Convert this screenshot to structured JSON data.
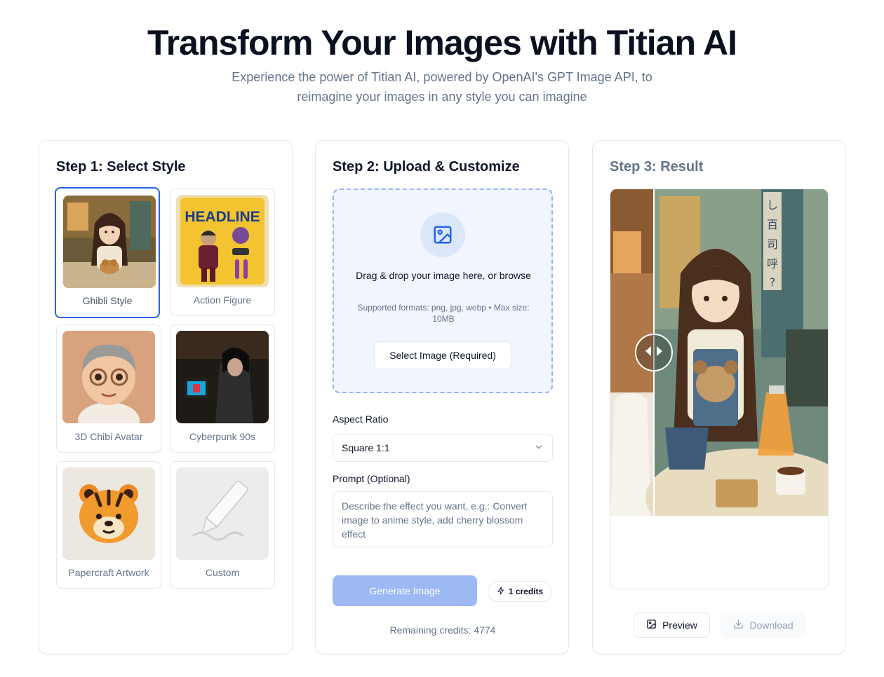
{
  "hero": {
    "title": "Transform Your Images with Titian AI",
    "subtitle_line1": "Experience the power of Titian AI, powered by OpenAI's GPT Image API, to",
    "subtitle_line2": "reimagine your images in any style you can imagine"
  },
  "step1": {
    "title": "Step 1: Select Style",
    "styles": [
      {
        "label": "Ghibli Style",
        "selected": true,
        "icon": "ghibli-girl-image"
      },
      {
        "label": "Action Figure",
        "selected": false,
        "icon": "action-figure-image"
      },
      {
        "label": "3D Chibi Avatar",
        "selected": false,
        "icon": "chibi-avatar-image"
      },
      {
        "label": "Cyberpunk 90s",
        "selected": false,
        "icon": "cyberpunk-image"
      },
      {
        "label": "Papercraft Artwork",
        "selected": false,
        "icon": "papercraft-tiger-image"
      },
      {
        "label": "Custom",
        "selected": false,
        "icon": "pencil-image"
      }
    ],
    "action_figure_headline": "HEADLINE"
  },
  "step2": {
    "title": "Step 2: Upload & Customize",
    "dropzone_main": "Drag & drop your image here, or browse",
    "dropzone_hint": "Supported formats: png, jpg, webp • Max size: 10MB",
    "select_button": "Select Image (Required)",
    "aspect_label": "Aspect Ratio",
    "aspect_value": "Square 1:1",
    "prompt_label": "Prompt (Optional)",
    "prompt_placeholder": "Describe the effect you want, e.g.: Convert image to anime style, add cherry blossom effect",
    "generate_button": "Generate Image",
    "credits_badge": "1 credits",
    "remaining": "Remaining credits: 4774"
  },
  "step3": {
    "title": "Step 3: Result",
    "preview_button": "Preview",
    "download_button": "Download",
    "sign_text": "し\n百\n司\n呼\n?"
  },
  "colors": {
    "accent": "#2563eb",
    "generate_disabled": "#9cb9f3",
    "muted_text": "#64748b"
  }
}
